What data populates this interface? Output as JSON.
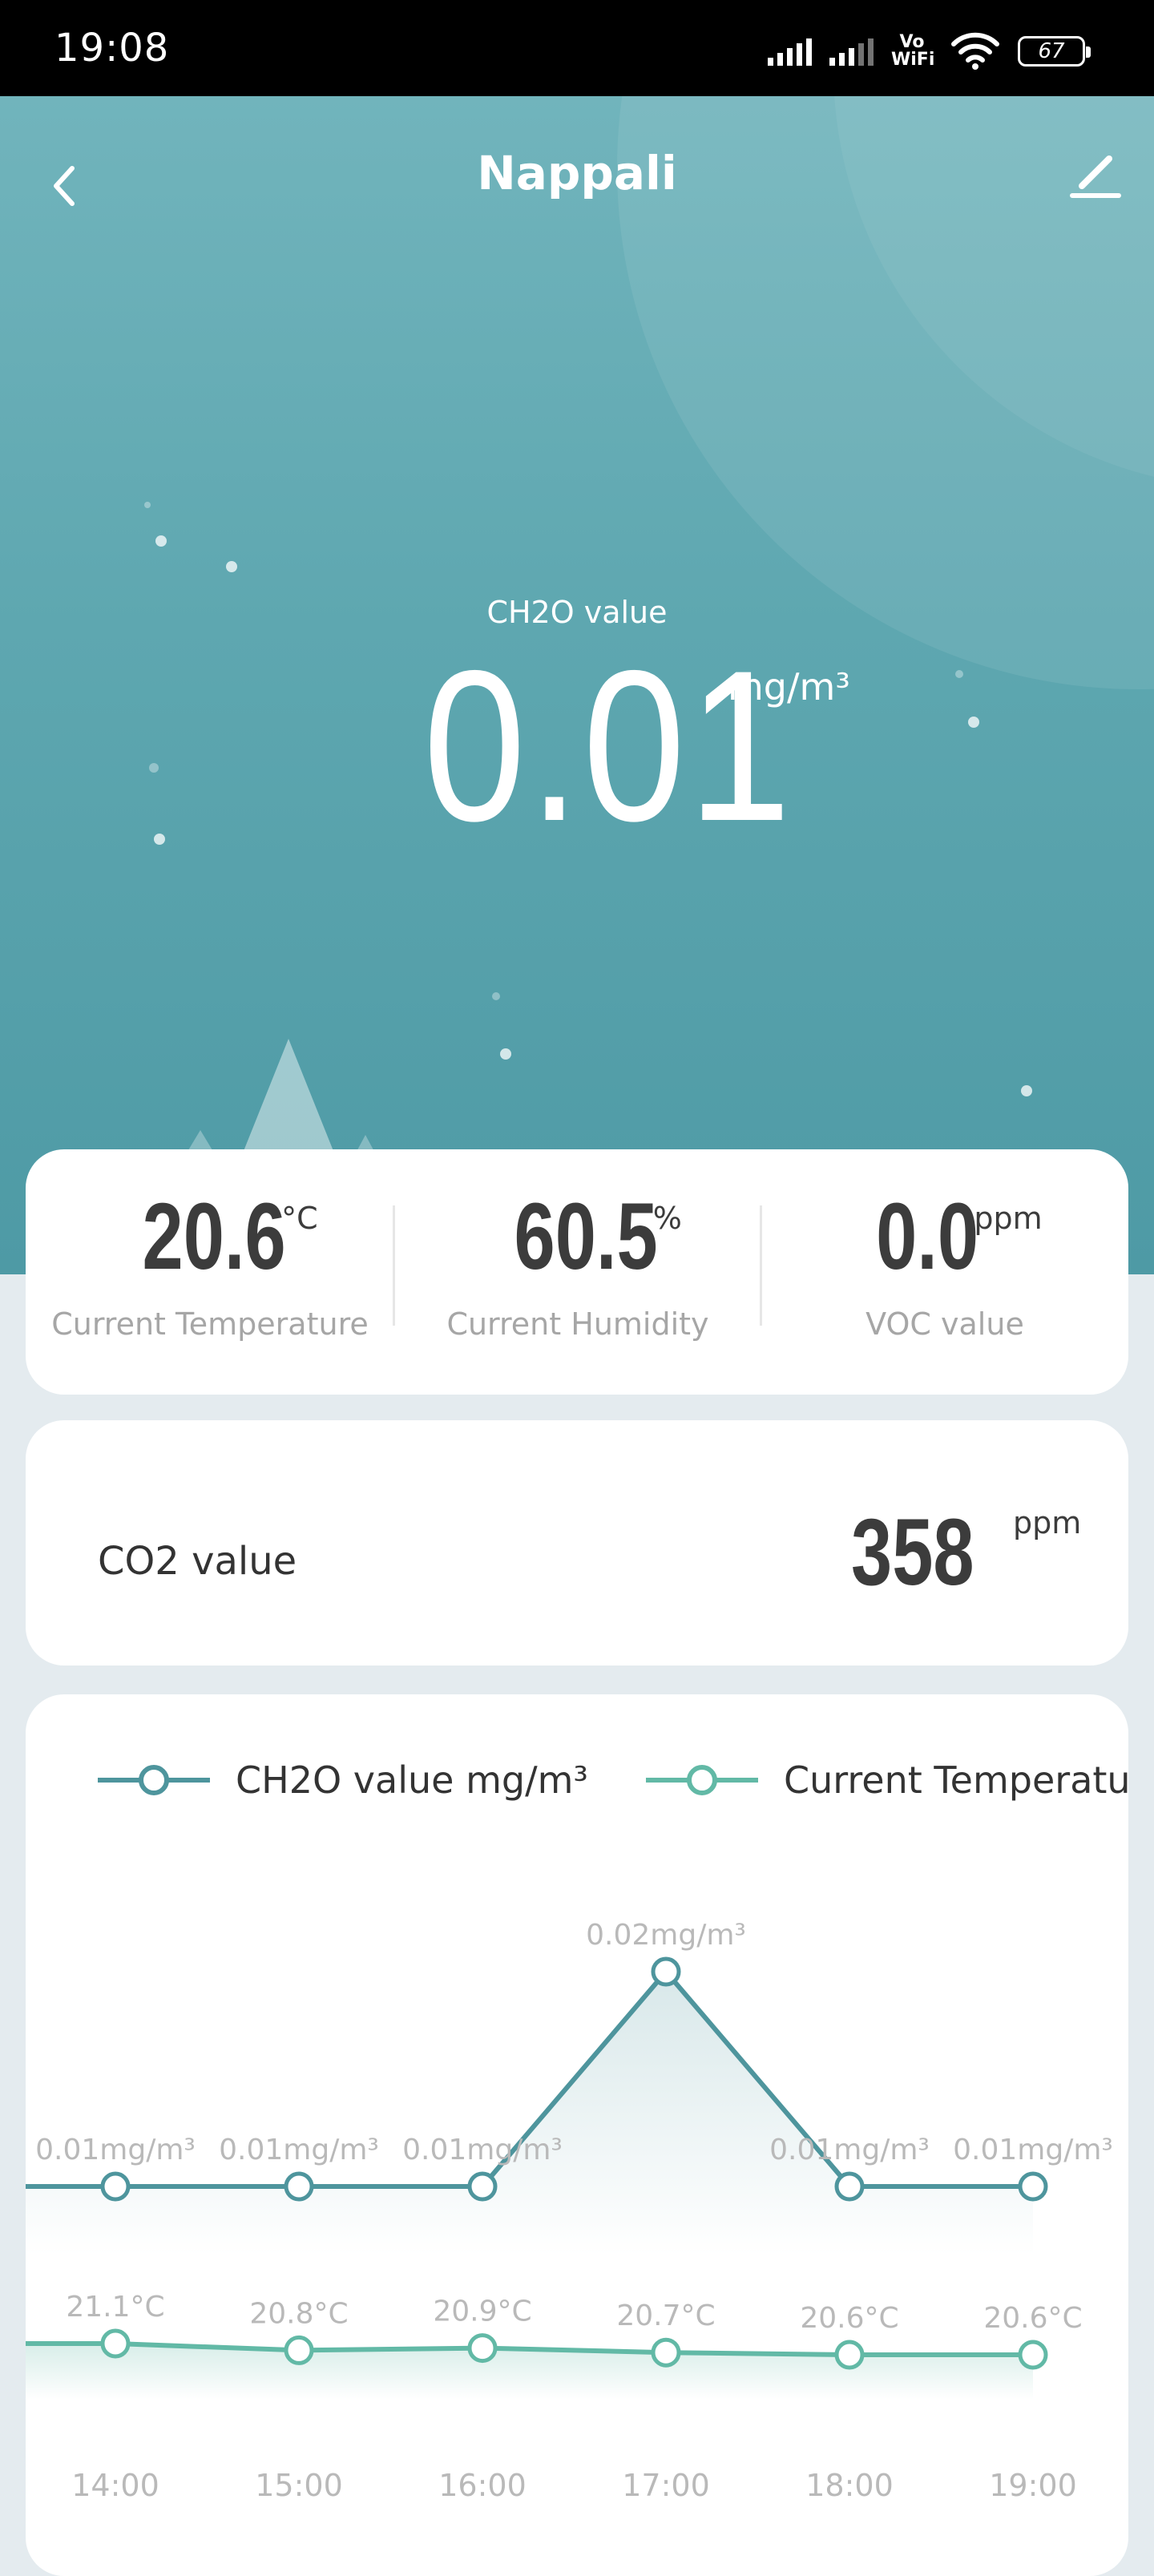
{
  "status_bar": {
    "time": "19:08",
    "volte": "Vo\nWiFi",
    "battery": "67"
  },
  "header": {
    "title": "Nappali"
  },
  "hero": {
    "ch2o_label": "CH2O value",
    "ch2o_value": "0.01",
    "ch2o_unit": "mg/m³"
  },
  "stats": [
    {
      "value": "20.6",
      "unit": "°C",
      "label": "Current Temperature"
    },
    {
      "value": "60.5",
      "unit": "%",
      "label": "Current Humidity"
    },
    {
      "value": "0.0",
      "unit": "ppm",
      "label": "VOC value"
    }
  ],
  "co2": {
    "label": "CO2 value",
    "value": "358",
    "unit": "ppm"
  },
  "colors": {
    "ch2o_line": "#4e959d",
    "temp_line": "#62b9a6",
    "label_gray": "#b9b9b9"
  },
  "chart_data": {
    "type": "line",
    "x": [
      "14:00",
      "15:00",
      "16:00",
      "17:00",
      "18:00",
      "19:00"
    ],
    "series": [
      {
        "name": "CH2O value mg/m³",
        "values": [
          0.01,
          0.01,
          0.01,
          0.02,
          0.01,
          0.01
        ],
        "labels": [
          "0.01mg/m³",
          "0.01mg/m³",
          "0.01mg/m³",
          "0.02mg/m³",
          "0.01mg/m³",
          "0.01mg/m³"
        ]
      },
      {
        "name": "Current Temperature",
        "values": [
          21.1,
          20.8,
          20.9,
          20.7,
          20.6,
          20.6
        ],
        "labels": [
          "21.1°C",
          "20.8°C",
          "20.9°C",
          "20.7°C",
          "20.6°C",
          "20.6°C"
        ]
      }
    ],
    "legend": "top"
  }
}
